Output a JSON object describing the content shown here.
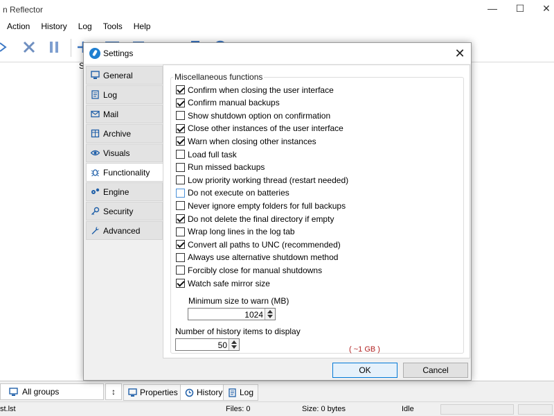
{
  "app": {
    "title": "n Reflector",
    "menu": [
      "Action",
      "History",
      "Log",
      "Tools",
      "Help"
    ],
    "toolbar_icons": [
      "forward-arrow-icon",
      "cancel-x-icon",
      "pause-icon",
      "add-icon",
      "window-icon",
      "clipboard-icon",
      "refresh-icon",
      "bookmark-icon",
      "target-icon"
    ],
    "column_stub": "S"
  },
  "bottom": {
    "groups_label": "All groups",
    "sort_glyph": "↕",
    "tabs": [
      {
        "label": "Properties",
        "icon": "monitor-icon"
      },
      {
        "label": "History",
        "icon": "history-icon"
      },
      {
        "label": "Log",
        "icon": "log-icon"
      }
    ]
  },
  "statusbar": {
    "file": "st.lst",
    "files": "Files: 0",
    "size": "Size: 0 bytes",
    "state": "Idle"
  },
  "dialog": {
    "title": "Settings",
    "close_glyph": "✕",
    "nav": [
      {
        "label": "General",
        "icon": "monitor-icon"
      },
      {
        "label": "Log",
        "icon": "log-icon"
      },
      {
        "label": "Mail",
        "icon": "mail-icon"
      },
      {
        "label": "Archive",
        "icon": "archive-icon"
      },
      {
        "label": "Visuals",
        "icon": "eye-icon"
      },
      {
        "label": "Functionality",
        "icon": "bug-icon"
      },
      {
        "label": "Engine",
        "icon": "gears-icon"
      },
      {
        "label": "Security",
        "icon": "key-icon"
      },
      {
        "label": "Advanced",
        "icon": "wrench-icon"
      }
    ],
    "active_nav": "Functionality",
    "group_title": "Miscellaneous functions",
    "options": [
      {
        "label": "Confirm when closing the user interface",
        "checked": true
      },
      {
        "label": "Confirm manual backups",
        "checked": true
      },
      {
        "label": "Show shutdown option on confirmation",
        "checked": false
      },
      {
        "label": "Close other instances of the user interface",
        "checked": true
      },
      {
        "label": "Warn when closing other instances",
        "checked": true
      },
      {
        "label": "Load full task",
        "checked": false
      },
      {
        "label": "Run missed backups",
        "checked": false
      },
      {
        "label": "Low priority working thread (restart needed)",
        "checked": false
      },
      {
        "label": "Do not execute on batteries",
        "checked": false,
        "focused": true
      },
      {
        "label": "Never ignore empty folders for full backups",
        "checked": false
      },
      {
        "label": "Do not delete the final directory if empty",
        "checked": true
      },
      {
        "label": "Wrap long lines in the log tab",
        "checked": false
      },
      {
        "label": "Convert all paths to UNC (recommended)",
        "checked": true
      },
      {
        "label": "Always use alternative shutdown method",
        "checked": false
      },
      {
        "label": "Forcibly close for manual shutdowns",
        "checked": false
      },
      {
        "label": "Watch safe mirror size",
        "checked": true
      }
    ],
    "min_size_label": "Minimum size to warn (MB)",
    "min_size_value": "1024",
    "min_size_hint": "( ~1 GB )",
    "history_label": "Number of history items to display",
    "history_value": "50",
    "ok_label": "OK",
    "cancel_label": "Cancel"
  }
}
